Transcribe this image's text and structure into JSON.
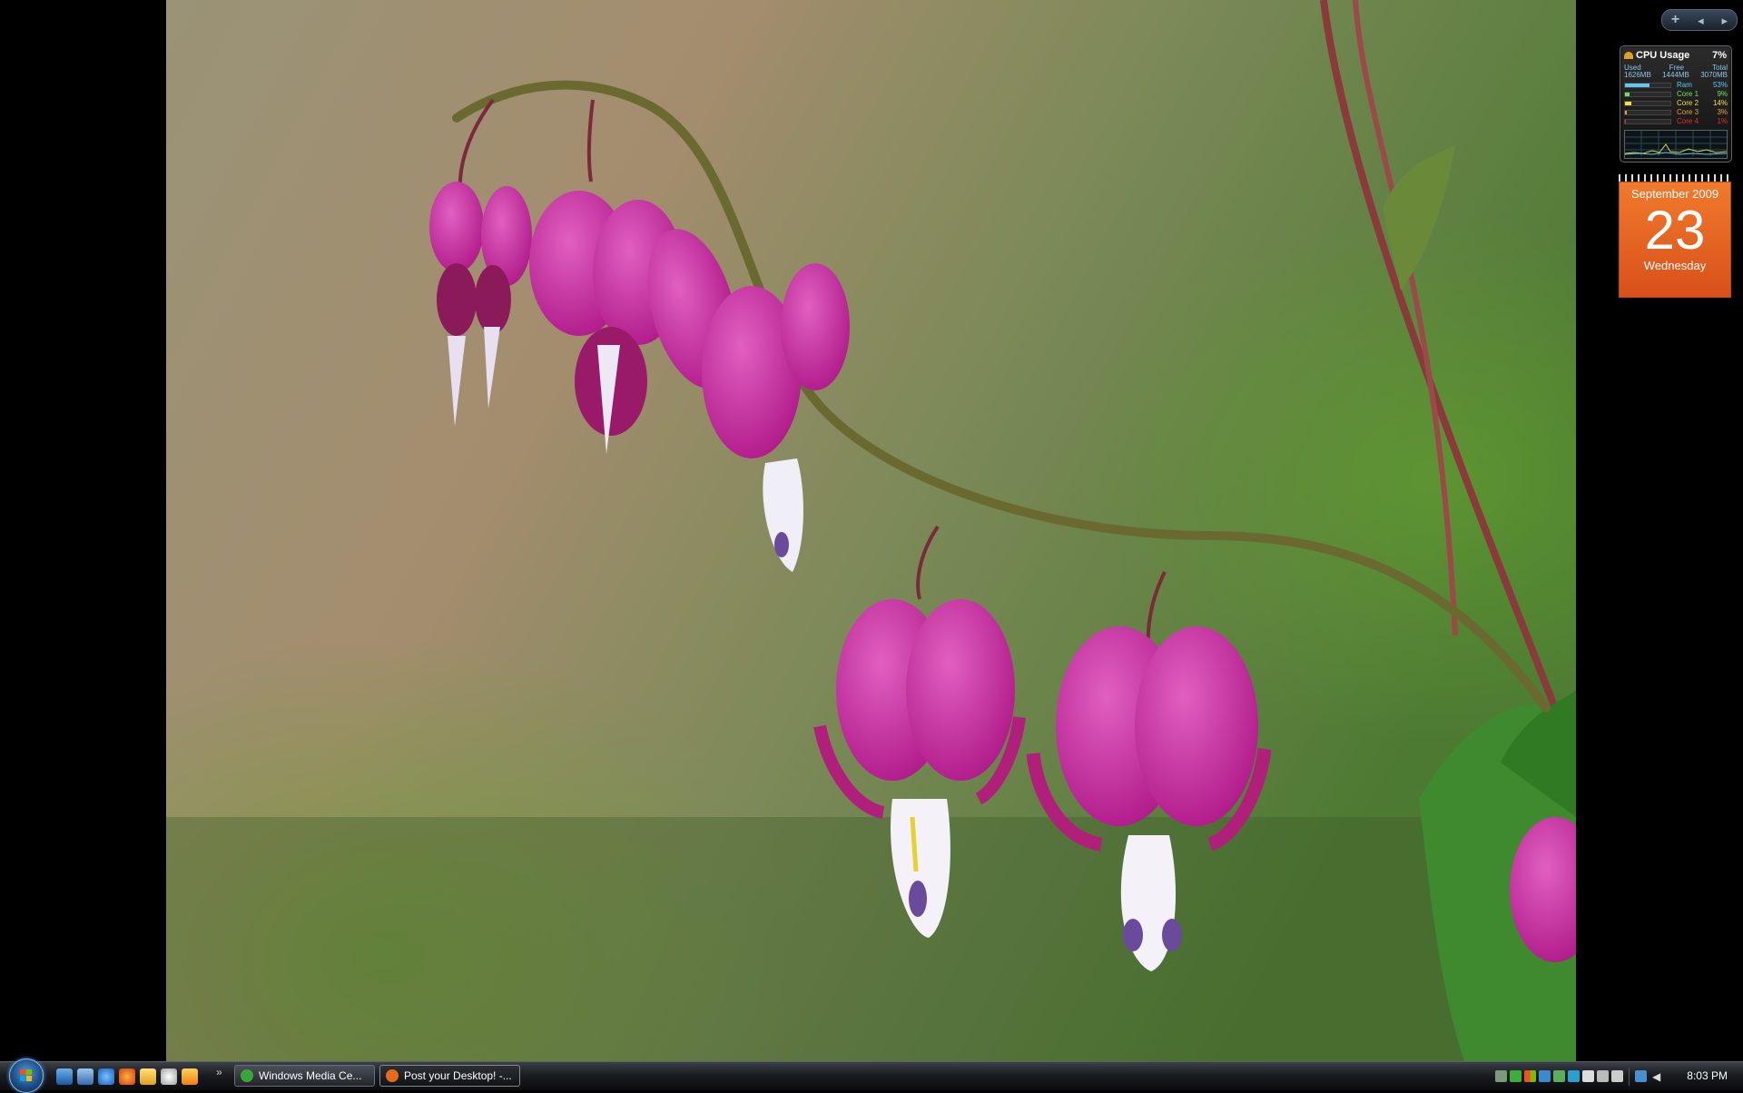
{
  "sidebar": {
    "add_gadget_label": "+",
    "prev_label": "◂",
    "next_label": "▸"
  },
  "cpu_gadget": {
    "title": "CPU Usage",
    "percent": "7%",
    "mem_headers": [
      "Used",
      "Free",
      "Total"
    ],
    "mem_values": [
      "1626MB",
      "1444MB",
      "3070MB"
    ],
    "rows": [
      {
        "label": "Ram",
        "value": "53%",
        "color": "#5ec8f0",
        "level": 0.53
      },
      {
        "label": "Core 1",
        "value": "9%",
        "color": "#6ee05a",
        "level": 0.09
      },
      {
        "label": "Core 2",
        "value": "14%",
        "color": "#f0e040",
        "level": 0.14
      },
      {
        "label": "Core 3",
        "value": "3%",
        "color": "#f0a030",
        "level": 0.03
      },
      {
        "label": "Core 4",
        "value": "1%",
        "color": "#e03030",
        "level": 0.01
      }
    ]
  },
  "calendar_gadget": {
    "month_year": "September 2009",
    "day": "23",
    "weekday": "Wednesday"
  },
  "taskbar": {
    "quick_launch_overflow": "»",
    "tasks": [
      {
        "label": "Windows Media Ce...",
        "icon_color": "#3aa63a",
        "active": false
      },
      {
        "label": "Post your Desktop! -...",
        "icon_color": "#e86a1a",
        "active": true
      }
    ],
    "clock": "8:03 PM"
  }
}
